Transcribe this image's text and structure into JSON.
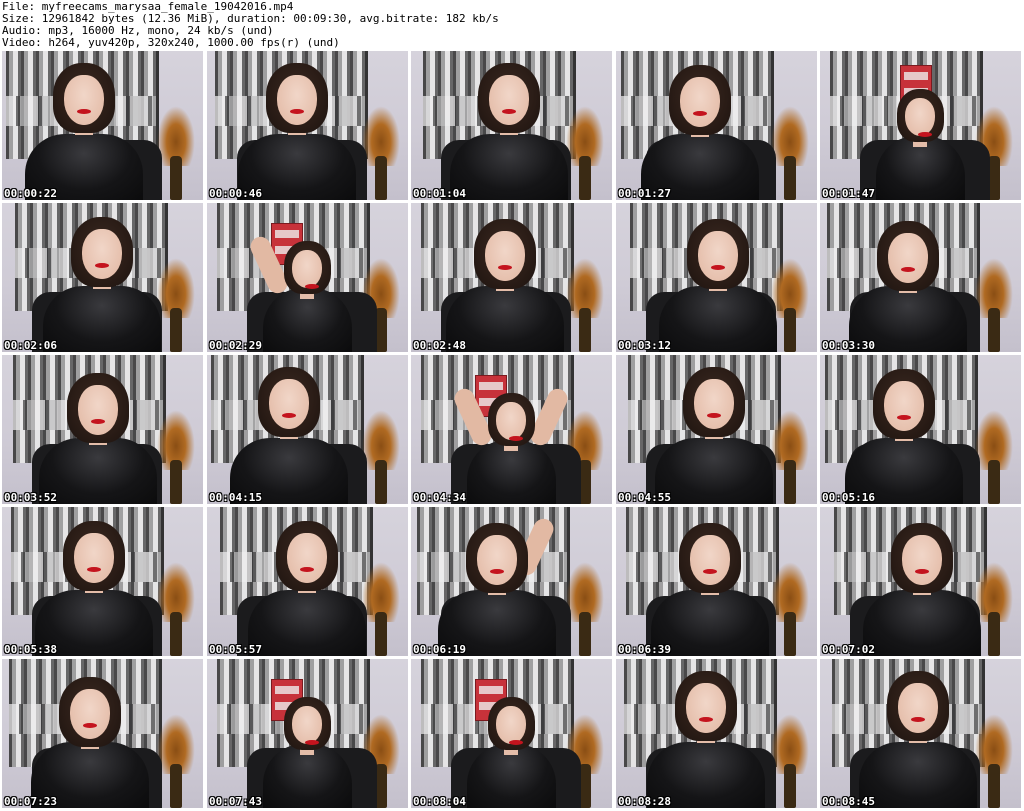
{
  "header": {
    "lines": [
      "File: myfreecams_marysaa_female_19042016.mp4",
      "Size: 12961842 bytes (12.36 MiB), duration: 00:09:30, avg.bitrate: 182 kb/s",
      "Audio: mp3, 16000 Hz, mono, 24 kb/s (und)",
      "Video: h264, yuv420p, 320x240, 1000.00 fps(r) (und)"
    ]
  },
  "thumbnails": [
    {
      "timestamp": "00:00:22",
      "pose": "sit"
    },
    {
      "timestamp": "00:00:46",
      "pose": "sit"
    },
    {
      "timestamp": "00:01:04",
      "pose": "sit"
    },
    {
      "timestamp": "00:01:27",
      "pose": "sit"
    },
    {
      "timestamp": "00:01:47",
      "pose": "far"
    },
    {
      "timestamp": "00:02:06",
      "pose": "sit"
    },
    {
      "timestamp": "00:02:29",
      "pose": "arm-up"
    },
    {
      "timestamp": "00:02:48",
      "pose": "sit"
    },
    {
      "timestamp": "00:03:12",
      "pose": "sit"
    },
    {
      "timestamp": "00:03:30",
      "pose": "sit"
    },
    {
      "timestamp": "00:03:52",
      "pose": "sit"
    },
    {
      "timestamp": "00:04:15",
      "pose": "sit"
    },
    {
      "timestamp": "00:04:34",
      "pose": "arms-up"
    },
    {
      "timestamp": "00:04:55",
      "pose": "sit"
    },
    {
      "timestamp": "00:05:16",
      "pose": "sit"
    },
    {
      "timestamp": "00:05:38",
      "pose": "sit"
    },
    {
      "timestamp": "00:05:57",
      "pose": "sit"
    },
    {
      "timestamp": "00:06:19",
      "pose": "hand-hair"
    },
    {
      "timestamp": "00:06:39",
      "pose": "sit"
    },
    {
      "timestamp": "00:07:02",
      "pose": "sit"
    },
    {
      "timestamp": "00:07:23",
      "pose": "sit"
    },
    {
      "timestamp": "00:07:43",
      "pose": "far"
    },
    {
      "timestamp": "00:08:04",
      "pose": "far"
    },
    {
      "timestamp": "00:08:28",
      "pose": "sit"
    },
    {
      "timestamp": "00:08:45",
      "pose": "sit"
    }
  ],
  "colors": {
    "background": "#ffffff",
    "timestamp_text": "#ffffff",
    "timestamp_outline": "#000000",
    "wall": "#d3d0da",
    "top": "#151517",
    "lips": "#c4141e",
    "bus": "#c7323a"
  }
}
